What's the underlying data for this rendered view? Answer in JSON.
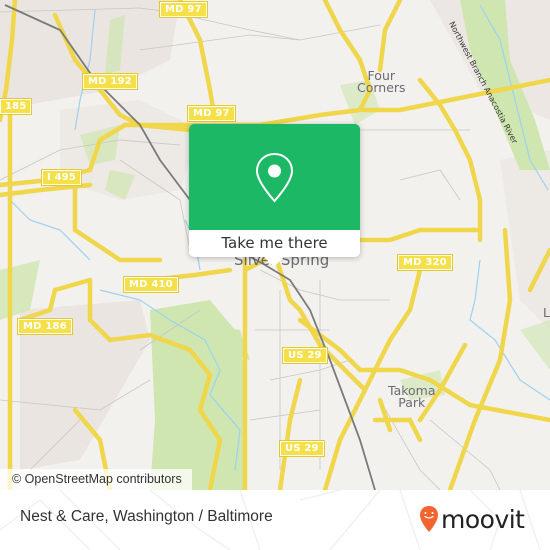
{
  "map": {
    "road_shields": [
      {
        "label": "MD 97"
      },
      {
        "label": "MD 192"
      },
      {
        "label": "185"
      },
      {
        "label": "MD 97"
      },
      {
        "label": "I 495"
      },
      {
        "label": "MD 410"
      },
      {
        "label": "MD 186"
      },
      {
        "label": "MD 320"
      },
      {
        "label": "US 29"
      },
      {
        "label": "US 29"
      }
    ],
    "places": {
      "four_corners": "Four\nCorners",
      "silver_spring": "Silver Spring",
      "takoma_park": "Takoma\nPark",
      "partial_right": "L"
    },
    "river_label": "Northwest Branch Anacostia River",
    "colors": {
      "background": "#f2f1ed",
      "park": "#cfe6b0",
      "road_major": "#f6e04a",
      "water": "#9cd2ef",
      "rail": "#777777",
      "residential": "#e9e3df"
    },
    "attribution": "© OpenStreetMap contributors"
  },
  "popup": {
    "icon": "map-pin-icon",
    "cta_label": "Take me there",
    "color": "#1db866"
  },
  "footer": {
    "place_title": "Nest & Care, Washington / Baltimore",
    "brand": "moovit",
    "brand_color": "#f26530"
  }
}
